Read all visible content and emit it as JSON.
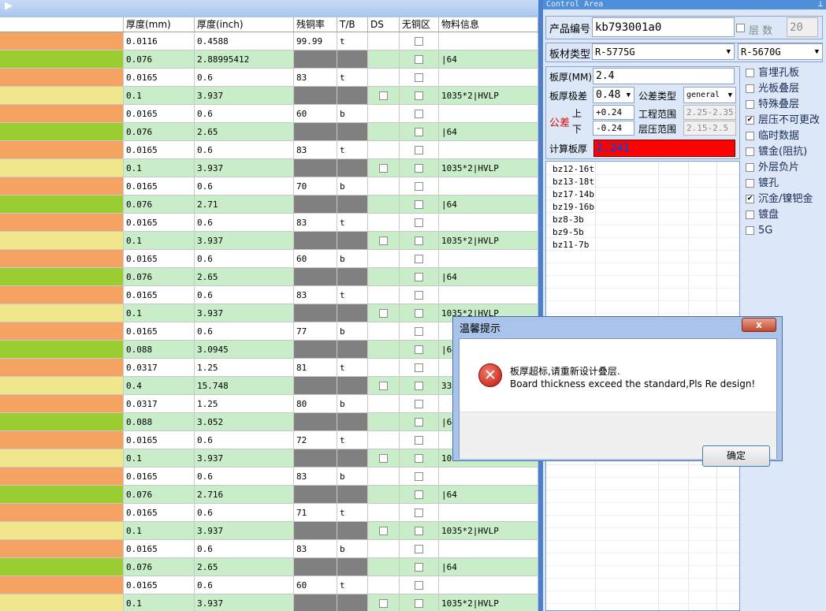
{
  "grid": {
    "headers": [
      "",
      "厚度(mm)",
      "厚度(inch)",
      "残铜率",
      "T/B",
      "DS",
      "无铜区",
      "物料信息"
    ],
    "colors": {
      "orange": "#f4a460",
      "green": "#9acd32",
      "yellow": "#f0e68c",
      "row_green": "#c9ecc9",
      "gray": "#808080"
    },
    "rows": [
      {
        "type": "core",
        "color": "orange",
        "mm": "0.0116",
        "inch": "0.4588",
        "copper": "99.99",
        "tb": "t",
        "info": ""
      },
      {
        "type": "pp",
        "color": "green",
        "mm": "0.076",
        "inch": "2.88995412",
        "info": "|64"
      },
      {
        "type": "core",
        "color": "orange",
        "mm": "0.0165",
        "inch": "0.6",
        "copper": "83",
        "tb": "t",
        "info": ""
      },
      {
        "type": "pp",
        "color": "yellow",
        "mm": "0.1",
        "inch": "3.937",
        "info": "1035*2|HVLP",
        "ds": true
      },
      {
        "type": "core",
        "color": "orange",
        "mm": "0.0165",
        "inch": "0.6",
        "copper": "60",
        "tb": "b",
        "info": ""
      },
      {
        "type": "pp",
        "color": "green",
        "mm": "0.076",
        "inch": "2.65",
        "info": "|64"
      },
      {
        "type": "core",
        "color": "orange",
        "mm": "0.0165",
        "inch": "0.6",
        "copper": "83",
        "tb": "t",
        "info": ""
      },
      {
        "type": "pp",
        "color": "yellow",
        "mm": "0.1",
        "inch": "3.937",
        "info": "1035*2|HVLP",
        "ds": true
      },
      {
        "type": "core",
        "color": "orange",
        "mm": "0.0165",
        "inch": "0.6",
        "copper": "70",
        "tb": "b",
        "info": ""
      },
      {
        "type": "pp",
        "color": "green",
        "mm": "0.076",
        "inch": "2.71",
        "info": "|64"
      },
      {
        "type": "core",
        "color": "orange",
        "mm": "0.0165",
        "inch": "0.6",
        "copper": "83",
        "tb": "t",
        "info": ""
      },
      {
        "type": "pp",
        "color": "yellow",
        "mm": "0.1",
        "inch": "3.937",
        "info": "1035*2|HVLP",
        "ds": true
      },
      {
        "type": "core",
        "color": "orange",
        "mm": "0.0165",
        "inch": "0.6",
        "copper": "60",
        "tb": "b",
        "info": ""
      },
      {
        "type": "pp",
        "color": "green",
        "mm": "0.076",
        "inch": "2.65",
        "info": "|64"
      },
      {
        "type": "core",
        "color": "orange",
        "mm": "0.0165",
        "inch": "0.6",
        "copper": "83",
        "tb": "t",
        "info": ""
      },
      {
        "type": "pp",
        "color": "yellow",
        "mm": "0.1",
        "inch": "3.937",
        "info": "1035*2|HVLP",
        "ds": true
      },
      {
        "type": "core",
        "color": "orange",
        "mm": "0.0165",
        "inch": "0.6",
        "copper": "77",
        "tb": "b",
        "info": ""
      },
      {
        "type": "pp",
        "color": "green",
        "mm": "0.088",
        "inch": "3.0945",
        "info": "|64"
      },
      {
        "type": "core",
        "color": "orange",
        "mm": "0.0317",
        "inch": "1.25",
        "copper": "81",
        "tb": "t",
        "info": ""
      },
      {
        "type": "pp",
        "color": "yellow",
        "mm": "0.4",
        "inch": "15.748",
        "info": "33",
        "ds": true
      },
      {
        "type": "core",
        "color": "orange",
        "mm": "0.0317",
        "inch": "1.25",
        "copper": "80",
        "tb": "b",
        "info": ""
      },
      {
        "type": "pp",
        "color": "green",
        "mm": "0.088",
        "inch": "3.052",
        "info": "|64"
      },
      {
        "type": "core",
        "color": "orange",
        "mm": "0.0165",
        "inch": "0.6",
        "copper": "72",
        "tb": "t",
        "info": ""
      },
      {
        "type": "pp",
        "color": "yellow",
        "mm": "0.1",
        "inch": "3.937",
        "info": "10",
        "ds": true
      },
      {
        "type": "core",
        "color": "orange",
        "mm": "0.0165",
        "inch": "0.6",
        "copper": "83",
        "tb": "b",
        "info": ""
      },
      {
        "type": "pp",
        "color": "green",
        "mm": "0.076",
        "inch": "2.716",
        "info": "|64"
      },
      {
        "type": "core",
        "color": "orange",
        "mm": "0.0165",
        "inch": "0.6",
        "copper": "71",
        "tb": "t",
        "info": ""
      },
      {
        "type": "pp",
        "color": "yellow",
        "mm": "0.1",
        "inch": "3.937",
        "info": "1035*2|HVLP",
        "ds": true
      },
      {
        "type": "core",
        "color": "orange",
        "mm": "0.0165",
        "inch": "0.6",
        "copper": "83",
        "tb": "b",
        "info": ""
      },
      {
        "type": "pp",
        "color": "green",
        "mm": "0.076",
        "inch": "2.65",
        "info": "|64"
      },
      {
        "type": "core",
        "color": "orange",
        "mm": "0.0165",
        "inch": "0.6",
        "copper": "60",
        "tb": "t",
        "info": ""
      },
      {
        "type": "pp",
        "color": "yellow",
        "mm": "0.1",
        "inch": "3.937",
        "info": "1035*2|HVLP",
        "ds": true
      }
    ]
  },
  "panel": {
    "title": "Control Area",
    "product_label": "产品编号",
    "product_value": "kb793001a0",
    "layers_label": "层  数",
    "layers_value": "20",
    "material_label": "板材类型",
    "material_1": "R-5775G",
    "material_2": "R-5670G",
    "thickness_label": "板厚(MM)",
    "thickness_value": "2.4",
    "tol_label": "板厚极差",
    "tol_value": "0.48",
    "tol_type_label": "公差类型",
    "tol_type_value": "general",
    "tolerance_label": "公差",
    "upper_label": "上",
    "lower_label": "下",
    "upper_value": "+0.24",
    "lower_value": "-0.24",
    "eng_range_label": "工程范围",
    "eng_range_value": "2.25-2.35",
    "press_range_label": "层压范围",
    "press_range_value": "2.15-2.5",
    "calc_label": "计算板厚",
    "calc_value": "2.241",
    "calc_color": "#ff0000",
    "options": [
      {
        "label": "盲埋孔板",
        "checked": false
      },
      {
        "label": "光板叠层",
        "checked": false
      },
      {
        "label": "特殊叠层",
        "checked": false
      },
      {
        "label": "层压不可更改",
        "checked": true
      },
      {
        "label": "临时数据",
        "checked": false
      },
      {
        "label": "镀金(阻抗)",
        "checked": false
      },
      {
        "label": "外层负片",
        "checked": false
      },
      {
        "label": "镀孔",
        "checked": false
      },
      {
        "label": "沉金/镍钯金",
        "checked": true
      },
      {
        "label": "镀盘",
        "checked": false
      },
      {
        "label": "5G",
        "checked": false
      }
    ],
    "list_items": [
      "bz12-16t",
      "bz13-18t",
      "bz17-14b",
      "bz19-16b",
      "bz8-3b",
      "bz9-5b",
      "bz11-7b"
    ]
  },
  "dialog": {
    "title": "温馨提示",
    "close": "x",
    "message_cn": "板厚超标,请重新设计叠层.",
    "message_en": "Board thickness exceed the standard,Pls Re design!",
    "ok": "确定"
  }
}
